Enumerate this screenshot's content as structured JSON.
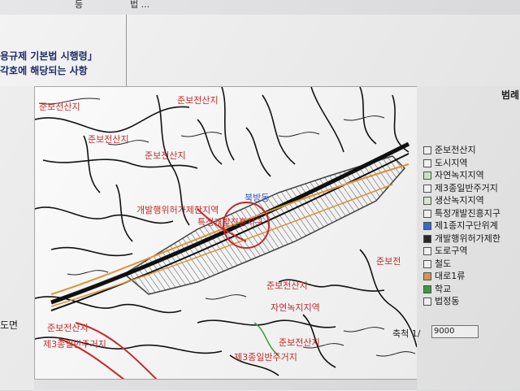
{
  "header": {
    "top_cell_label": "등",
    "top_cell_text": "법 ...",
    "law_line1": "용규제 기본법 시행령」",
    "law_line2": "각호에 해당되는 사항"
  },
  "side": {
    "map_row_label": "도면"
  },
  "legend": {
    "title": "범례",
    "items": [
      {
        "label": "준보전산지",
        "color": "#ffffff"
      },
      {
        "label": "도시지역",
        "color": "#ffffff"
      },
      {
        "label": "자연녹지지역",
        "color": "#d9efc7"
      },
      {
        "label": "제3종일반주거지",
        "color": "#ffffff"
      },
      {
        "label": "생산녹지지역",
        "color": "#e8f2d8"
      },
      {
        "label": "특정개발진흥지구",
        "color": "#ffffff"
      },
      {
        "label": "제1종지구단위계",
        "color": "#3b6fd1"
      },
      {
        "label": "개발행위허가제한",
        "color": "#2a2a2a"
      },
      {
        "label": "도로구역",
        "color": "#ffffff"
      },
      {
        "label": "철도",
        "color": "#ffffff"
      },
      {
        "label": "대로1류",
        "color": "#e0a05a"
      },
      {
        "label": "학교",
        "color": "#3fa43f"
      },
      {
        "label": "법정동",
        "color": "#ffffff"
      }
    ]
  },
  "scale": {
    "label": "축척 1/",
    "value": "9000"
  },
  "map": {
    "labels": [
      {
        "text": "준보전산지",
        "color": "#cf2a2a"
      },
      {
        "text": "준보전산지",
        "color": "#cf2a2a"
      },
      {
        "text": "준보전산지",
        "color": "#cf2a2a"
      },
      {
        "text": "준보전산지",
        "color": "#cf2a2a"
      },
      {
        "text": "개발행위허가제한지역",
        "color": "#cf2a2a"
      },
      {
        "text": "특정개발진흥지구",
        "color": "#cf2a2a"
      },
      {
        "text": "북방동",
        "color": "#2f56c9"
      },
      {
        "text": "준보전산지",
        "color": "#cf2a2a"
      },
      {
        "text": "준보전산지",
        "color": "#cf2a2a"
      },
      {
        "text": "자연녹지지역",
        "color": "#cf2a2a"
      },
      {
        "text": "제3종일반주거지",
        "color": "#cf2a2a"
      },
      {
        "text": "제3종일반주거지",
        "color": "#cf2a2a"
      },
      {
        "text": "준보전산지",
        "color": "#cf2a2a"
      },
      {
        "text": "준보전",
        "color": "#cf2a2a"
      }
    ]
  }
}
